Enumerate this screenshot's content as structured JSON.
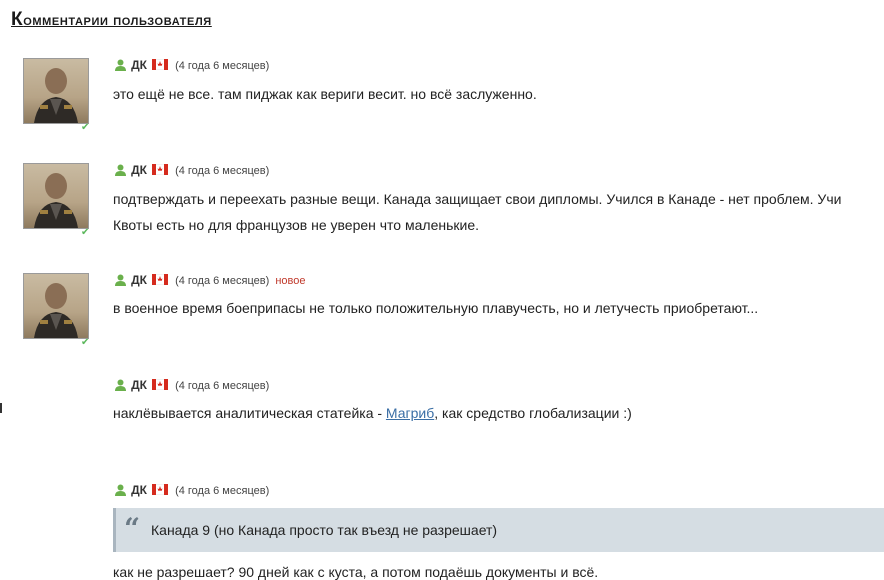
{
  "section_title": {
    "first": "К",
    "rest": "омментарии пользователя"
  },
  "comments": [
    {
      "user": "ДК",
      "age": "(4 года 6 месяцев)",
      "badge": "",
      "lines": [
        "это ещё не все. там пиджак как вериги весит. но всё заслуженно."
      ]
    },
    {
      "user": "ДК",
      "age": "(4 года 6 месяцев)",
      "badge": "",
      "lines": [
        "подтверждать и переехать разные вещи. Канада защищает свои дипломы. Учился в Канаде - нет проблем. Учи",
        "Квоты есть но для французов не уверен что маленькие."
      ]
    },
    {
      "user": "ДК",
      "age": "(4 года 6 месяцев)",
      "badge": "новое",
      "lines": [
        "в военное время боеприпасы не только положительную плавучесть, но и летучесть приобретают..."
      ]
    },
    {
      "user": "ДК",
      "age": "(4 года 6 месяцев)",
      "badge": "",
      "text_before_link": "наклёвывается аналитическая статейка - ",
      "link": "Магриб",
      "text_after_link": ", как средство глобализации :)"
    },
    {
      "user": "ДК",
      "age": "(4 года 6 месяцев)",
      "badge": "",
      "quote_mark": "“",
      "quote": "Канада 9 (но Канада просто так въезд не разрешает)",
      "lines": [
        "как не разрешает? 90 дней как с куста, а потом подаёшь документы и всё."
      ]
    }
  ],
  "colors": {
    "link": "#3a6ea5",
    "new_badge": "#c0392b",
    "online_check": "#5cb85c",
    "quote_bg": "#d5dde3"
  },
  "icons": {
    "user": "user-icon",
    "flag": "canada-flag-icon",
    "check": "check-icon"
  }
}
